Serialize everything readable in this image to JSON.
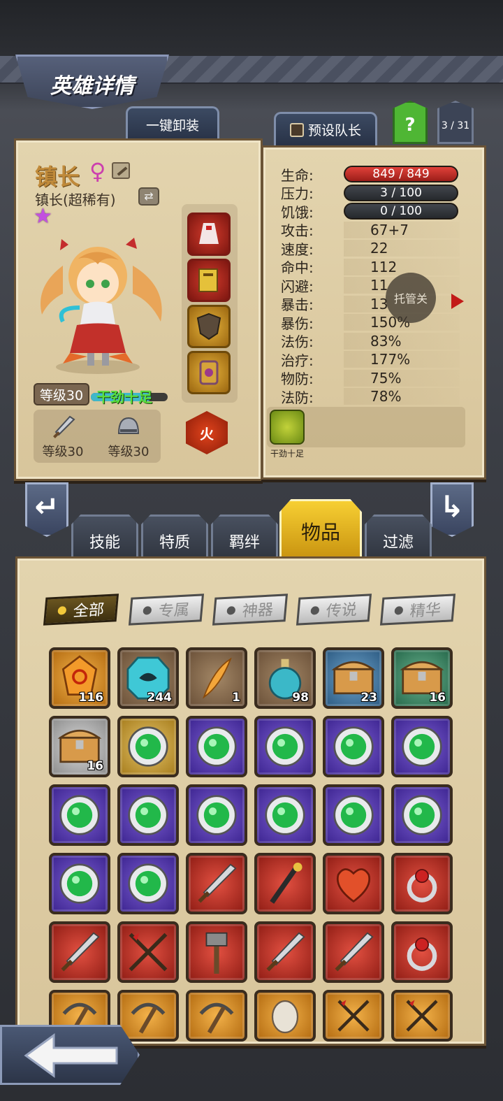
{
  "header": {
    "title": "英雄详情",
    "unequip_all": "一键卸装",
    "preset_captain": "预设队长",
    "help": "?",
    "page_indicator": "3 / 31"
  },
  "hero": {
    "name": "镇长",
    "class_label": "镇长(超稀有)",
    "level_badge": "等级30",
    "mood": "干劲十足",
    "mood_level": 0.78,
    "weapon_level": "等级30",
    "armor_level": "等级30",
    "element": "火",
    "gear": [
      "cloak-icon",
      "book-icon",
      "shield-icon",
      "rune-icon"
    ]
  },
  "stats": {
    "rows": [
      {
        "label": "生命:",
        "value": "849 / 849",
        "bar": "red"
      },
      {
        "label": "压力:",
        "value": "3 / 100",
        "bar": "dark"
      },
      {
        "label": "饥饿:",
        "value": "0 / 100",
        "bar": "dark"
      },
      {
        "label": "攻击:",
        "value": "67+7"
      },
      {
        "label": "速度:",
        "value": "22"
      },
      {
        "label": "命中:",
        "value": "112"
      },
      {
        "label": "闪避:",
        "value": "11"
      },
      {
        "label": "暴击:",
        "value": "13"
      },
      {
        "label": "暴伤:",
        "value": "150%"
      },
      {
        "label": "法伤:",
        "value": "83%"
      },
      {
        "label": "治疗:",
        "value": "177%"
      },
      {
        "label": "物防:",
        "value": "75%"
      },
      {
        "label": "法防:",
        "value": "78%"
      }
    ],
    "trustee": "托管关",
    "trait_label": "干劲十足"
  },
  "tabs": [
    "技能",
    "特质",
    "羁绊",
    "物品",
    "过滤"
  ],
  "active_tab": "物品",
  "filters": [
    "全部",
    "专属",
    "神器",
    "传说",
    "精华"
  ],
  "inventory": {
    "quantities": [
      "116",
      "244",
      "1",
      "98",
      "23",
      "16",
      "16"
    ],
    "rows": [
      [
        "gem-orange",
        "rune-teal",
        "feather-quill",
        "potion-blue",
        "chest-blue",
        "chest-green"
      ],
      [
        "chest-grey",
        "orb-gold",
        "orb-purple",
        "orb-purple",
        "orb-purple",
        "orb-purple"
      ],
      [
        "orb-purple",
        "orb-purple",
        "orb-purple",
        "orb-purple",
        "orb-purple",
        "orb-purple"
      ],
      [
        "orb-purple",
        "orb-purple",
        "sword-red",
        "staff-red",
        "heart-armor-red",
        "amulet-red"
      ],
      [
        "dagger-red",
        "bow-red",
        "hammer-red",
        "blade-red",
        "sword-jeweled-red",
        "ring-red"
      ],
      [
        "axe-orange",
        "pickaxe-orange",
        "pickaxe-orange",
        "mask-orange",
        "crossed-swords-orange",
        "crossbow-orange"
      ]
    ]
  },
  "colors": {
    "parchment": "#e3d4ae",
    "accent_gold": "#f2c83a",
    "hp_red": "#d8312b",
    "mood_green": "#5bde3c"
  }
}
